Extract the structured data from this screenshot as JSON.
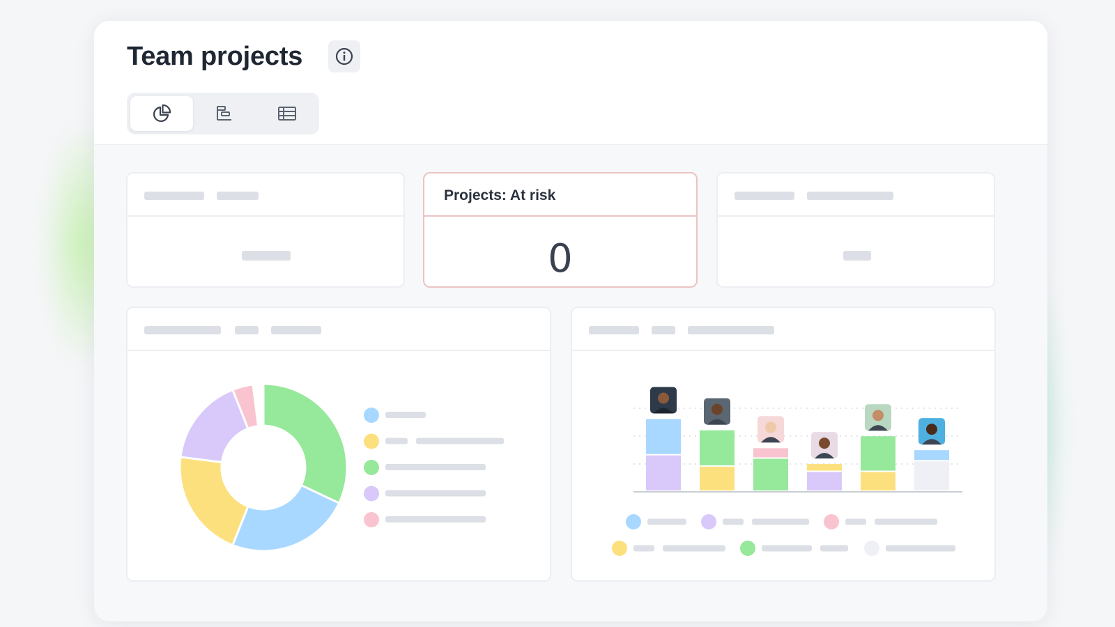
{
  "header": {
    "title": "Team projects",
    "info_icon": "info-icon",
    "views": [
      {
        "icon": "pie-chart-icon",
        "active": true
      },
      {
        "icon": "timeline-icon",
        "active": false
      },
      {
        "icon": "table-icon",
        "active": false
      }
    ]
  },
  "kpi_cards": [
    {
      "title": "",
      "value": ""
    },
    {
      "title": "Projects: At risk",
      "value": "0",
      "accent": "#ecc3c3"
    },
    {
      "title": "",
      "value": ""
    }
  ],
  "donut": {
    "legend_colors": [
      "#a8d8ff",
      "#fde07e",
      "#96e89a",
      "#d8c9fa",
      "#f9c4cf"
    ],
    "segments": [
      {
        "color": "#96e89a",
        "fraction": 0.32
      },
      {
        "color": "#a8d8ff",
        "fraction": 0.24
      },
      {
        "color": "#fde07e",
        "fraction": 0.21
      },
      {
        "color": "#d8c9fa",
        "fraction": 0.17
      },
      {
        "color": "#f9c4cf",
        "fraction": 0.04
      }
    ]
  },
  "bar_chart": {
    "members": [
      {
        "avatar": "avatar-1",
        "stack": [
          {
            "color": "#d8c9fa",
            "value": 55
          },
          {
            "color": "#a8d8ff",
            "value": 55
          }
        ]
      },
      {
        "avatar": "avatar-2",
        "stack": [
          {
            "color": "#fde07e",
            "value": 38
          },
          {
            "color": "#96e89a",
            "value": 55
          }
        ]
      },
      {
        "avatar": "avatar-3",
        "stack": [
          {
            "color": "#96e89a",
            "value": 50
          },
          {
            "color": "#f9c4cf",
            "value": 16
          }
        ]
      },
      {
        "avatar": "avatar-4",
        "stack": [
          {
            "color": "#d8c9fa",
            "value": 30
          },
          {
            "color": "#fde07e",
            "value": 12
          }
        ]
      },
      {
        "avatar": "avatar-5",
        "stack": [
          {
            "color": "#fde07e",
            "value": 30
          },
          {
            "color": "#96e89a",
            "value": 54
          }
        ]
      },
      {
        "avatar": "avatar-6",
        "stack": [
          {
            "color": "#eef0f5",
            "value": 46
          },
          {
            "color": "#a8d8ff",
            "value": 17
          }
        ]
      }
    ],
    "legend_colors": [
      "#a8d8ff",
      "#d8c9fa",
      "#f9c4cf",
      "#fde07e",
      "#96e89a",
      "#eef0f5"
    ]
  }
}
